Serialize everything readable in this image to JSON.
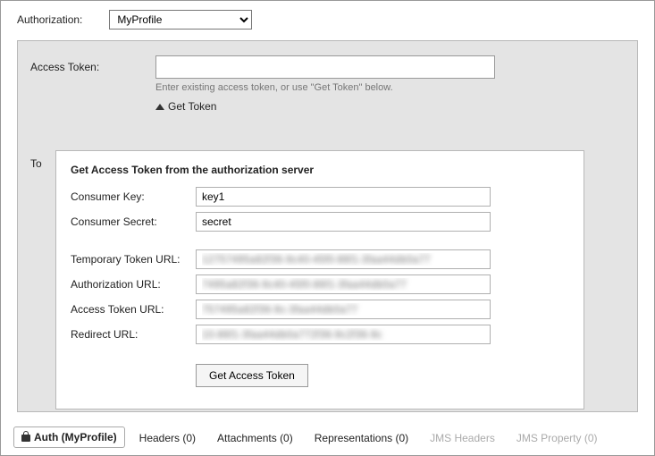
{
  "header": {
    "authorization_label": "Authorization:",
    "profile_selected": "MyProfile"
  },
  "panel": {
    "access_token_label": "Access Token:",
    "access_token_value": "",
    "access_token_helper": "Enter existing access token, or use \"Get Token\" below.",
    "get_token_toggle": "Get Token",
    "token_section_label": "To"
  },
  "popup": {
    "title": "Get Access Token from the authorization server",
    "consumer_key_label": "Consumer Key:",
    "consumer_key_value": "key1",
    "consumer_secret_label": "Consumer Secret:",
    "consumer_secret_value": "secret",
    "temp_token_url_label": "Temporary Token URL:",
    "temp_token_url_value": "12757495a82f36-9c40-45f0-86f1-3faa44db0a77",
    "authorization_url_label": "Authorization URL:",
    "authorization_url_value": "7495a82f36-9c40-45f0-86f1-3faa44db0a77",
    "access_token_url_label": "Access Token URL:",
    "access_token_url_value": "757495a82f36-9c-3faa44db0a77",
    "redirect_url_label": "Redirect URL:",
    "redirect_url_value": "10-86f1-3faa44db0a772f36-9c2f36-9c",
    "get_access_token_btn": "Get Access Token"
  },
  "tabs": {
    "auth": "Auth (MyProfile)",
    "headers": "Headers (0)",
    "attachments": "Attachments (0)",
    "representations": "Representations (0)",
    "jms_headers": "JMS Headers",
    "jms_property": "JMS Property (0)"
  }
}
